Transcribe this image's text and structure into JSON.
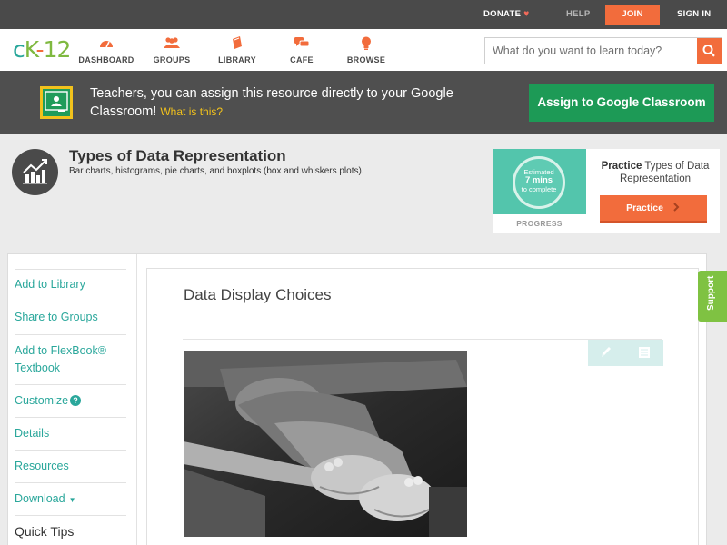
{
  "topbar": {
    "donate": "DONATE",
    "help": "HELP",
    "join": "JOIN",
    "signin": "SIGN IN"
  },
  "logo": {
    "c": "c",
    "k": "K",
    "dash": "-",
    "num": "12"
  },
  "nav": {
    "dashboard": "DASHBOARD",
    "groups": "GROUPS",
    "library": "LIBRARY",
    "cafe": "CAFE",
    "browse": "BROWSE"
  },
  "search": {
    "placeholder": "What do you want to learn today?"
  },
  "classroom": {
    "message": "Teachers, you can assign this resource directly to your Google Classroom!",
    "what_is_this": "What is this?",
    "assign_button": "Assign to Google Classroom"
  },
  "concept": {
    "title": "Types of Data Representation",
    "subtitle": "Bar charts, histograms, pie charts, and boxplots (box and whiskers plots)."
  },
  "practice": {
    "estimated": "Estimated",
    "minutes": "7 mins",
    "to_complete": "to complete",
    "progress_label": "PROGRESS",
    "title_bold": "Practice",
    "title_rest": "Types of Data Representation",
    "button": "Practice"
  },
  "sidebar": {
    "items": [
      {
        "label": "Add to Library"
      },
      {
        "label": "Share to Groups"
      },
      {
        "label": "Add to FlexBook® Textbook"
      },
      {
        "label": "Customize"
      },
      {
        "label": "Details"
      },
      {
        "label": "Resources"
      },
      {
        "label": "Download"
      },
      {
        "label": "Quick Tips"
      }
    ],
    "customize_help": "?"
  },
  "content": {
    "title": "Data Display Choices"
  },
  "support": "Support",
  "colors": {
    "brand_orange": "#f26c3c",
    "teal": "#2aa79b",
    "classroom_green": "#1d9a56",
    "support_green": "#7fc242"
  }
}
